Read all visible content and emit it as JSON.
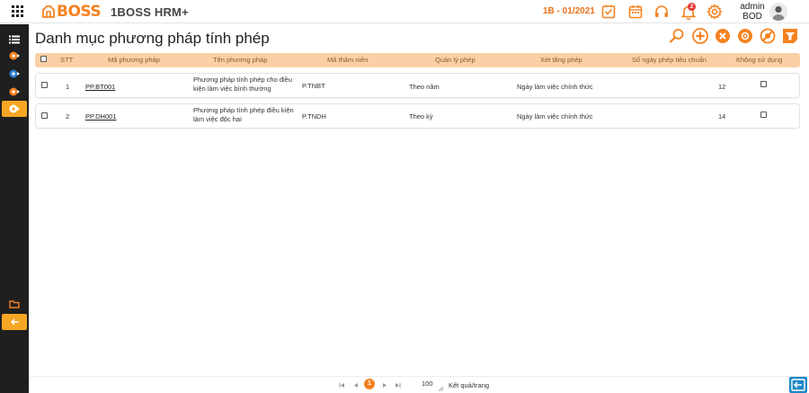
{
  "app": {
    "logo_text": "BOSS",
    "name": "1BOSS HRM+",
    "period": "1B - 01/2021",
    "notification_count": "2",
    "user_name": "admin",
    "user_role": "BOD"
  },
  "page": {
    "title": "Danh mục phương pháp tính phép"
  },
  "table": {
    "headers": {
      "stt": "STT",
      "code": "Mã phương pháp",
      "name": "Tên phương pháp",
      "seniority_code": "Mã thâm niên",
      "leave_management": "Quản lý phép",
      "increase_consideration": "Xét tăng phép",
      "standard_days": "Số ngày phép tiêu chuẩn",
      "unused": "Không sử dụng"
    },
    "rows": [
      {
        "stt": "1",
        "code": "PP.BT001",
        "name": "Phương pháp tính phép cho điều kiện làm việc bình thường",
        "seniority_code": "P.TNBT",
        "leave_management": "Theo năm",
        "increase_consideration": "Ngày làm việc chính thức",
        "standard_days": "12"
      },
      {
        "stt": "2",
        "code": "PP.DH001",
        "name": "Phương pháp tính phép điều kiện làm việc độc hại",
        "seniority_code": "P.TNDH",
        "leave_management": "Theo kỳ",
        "increase_consideration": "Ngày làm việc chính thức",
        "standard_days": "14"
      }
    ]
  },
  "pagination": {
    "current_page": "1",
    "page_size": "100",
    "page_size_label": "Kết quả/trang"
  },
  "colors": {
    "accent": "#f58220",
    "header_bg": "#fbd0a6",
    "sidebar_bg": "#1f1f1f",
    "sidebar_active": "#f5a623"
  }
}
